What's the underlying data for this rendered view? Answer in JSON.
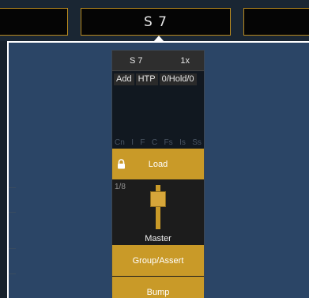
{
  "top_tabs": {
    "center_label": "S 7"
  },
  "fader": {
    "header": {
      "name": "S 7",
      "rate": "1x"
    },
    "badges": [
      "Add",
      "HTP",
      "0/Hold/0"
    ],
    "flags": [
      "Cn",
      "I",
      "F",
      "C",
      "Fs",
      "Is",
      "Ss"
    ],
    "load_label": "Load",
    "level_label": "1/8",
    "fader_label": "Master",
    "group_assert_label": "Group/Assert",
    "bump_label": "Bump"
  },
  "colors": {
    "accent_gold": "#c99a28",
    "popup_blue": "#2b4566",
    "card_bg": "#121820"
  }
}
